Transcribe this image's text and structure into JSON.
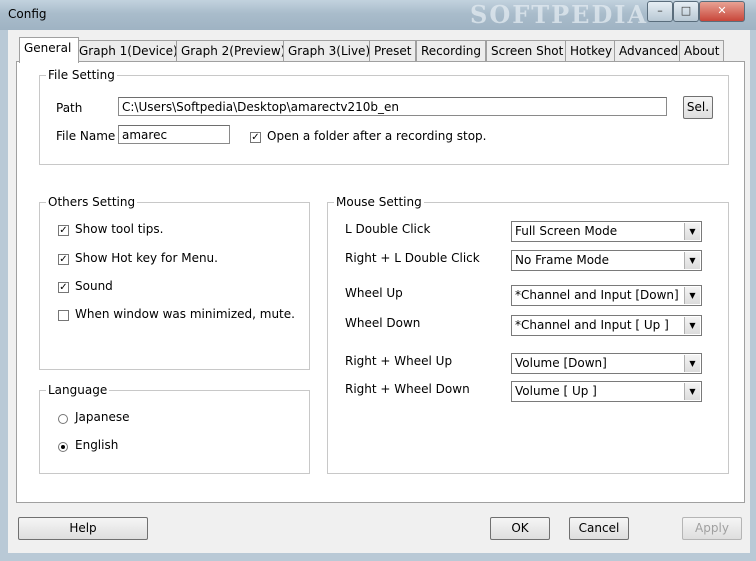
{
  "window": {
    "title": "Config",
    "watermark": "SOFTPEDIA",
    "controls": [
      "–",
      "□",
      "✕"
    ]
  },
  "tabs": [
    {
      "label": "General",
      "active": true
    },
    {
      "label": "Graph 1(Device)"
    },
    {
      "label": "Graph 2(Preview)"
    },
    {
      "label": "Graph 3(Live)"
    },
    {
      "label": "Preset"
    },
    {
      "label": "Recording"
    },
    {
      "label": "Screen Shot"
    },
    {
      "label": "Hotkey"
    },
    {
      "label": "Advanced"
    },
    {
      "label": "About"
    }
  ],
  "file_setting": {
    "title": "File Setting",
    "path_label": "Path",
    "path_value": "C:\\Users\\Softpedia\\Desktop\\amarectv210b_en",
    "sel_button": "Sel.",
    "filename_label": "File Name",
    "filename_value": "amarec",
    "open_folder_label": "Open a folder after a recording stop.",
    "open_folder_checked": true
  },
  "others_setting": {
    "title": "Others Setting",
    "items": [
      {
        "label": "Show tool tips.",
        "checked": true
      },
      {
        "label": "Show Hot key for Menu.",
        "checked": true
      },
      {
        "label": "Sound",
        "checked": true
      },
      {
        "label": "When window was minimized, mute.",
        "checked": false
      }
    ]
  },
  "language": {
    "title": "Language",
    "options": [
      {
        "label": "Japanese",
        "selected": false
      },
      {
        "label": "English",
        "selected": true
      }
    ]
  },
  "mouse_setting": {
    "title": "Mouse Setting",
    "rows": [
      {
        "label": "L Double Click",
        "value": "Full Screen Mode"
      },
      {
        "label": "Right + L Double Click",
        "value": "No Frame Mode"
      },
      {
        "label": "Wheel Up",
        "value": "*Channel and Input [Down]"
      },
      {
        "label": "Wheel Down",
        "value": "*Channel and Input [ Up ]"
      },
      {
        "label": "Right + Wheel Up",
        "value": "Volume [Down]"
      },
      {
        "label": "Right + Wheel Down",
        "value": "Volume [ Up ]"
      }
    ]
  },
  "buttons": {
    "help": "Help",
    "ok": "OK",
    "cancel": "Cancel",
    "apply": "Apply"
  },
  "check_mark": "✓",
  "dropdown_arrow": "▼"
}
